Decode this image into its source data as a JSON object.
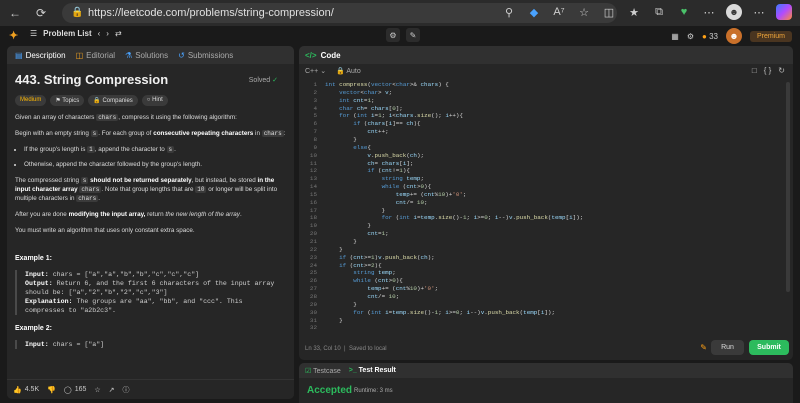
{
  "browser": {
    "url": "https://leetcode.com/problems/string-compression/"
  },
  "topbar": {
    "problem_list": "Problem List",
    "streak": "33",
    "premium": "Premium"
  },
  "left": {
    "tabs": [
      "Description",
      "Editorial",
      "Solutions",
      "Submissions"
    ],
    "title": "443. String Compression",
    "solved": "Solved",
    "tags": [
      "Medium",
      "Topics",
      "Companies",
      "Hint"
    ],
    "p1": "Given an array of characters",
    "p1_code": "chars",
    "p1_end": ", compress it using the following algorithm:",
    "p2a": "Begin with an empty string",
    "p2_code_s": "s",
    "p2b": ". For each group of",
    "p2_bold": "consecutive repeating characters",
    "p2c": "in",
    "p2_code_chars": "chars",
    "p2d": ":",
    "bullet1a": "If the group's length is",
    "bullet1_code1": "1",
    "bullet1b": ", append the character to",
    "bullet1_code2": "s",
    "bullet1c": ".",
    "bullet2": "Otherwise, append the character followed by the group's length.",
    "p3a": "The compressed string",
    "p3_code_s": "s",
    "p3_bold1": "should not be returned separately",
    "p3b": ", but instead, be stored",
    "p3_bold2": "in the input character array",
    "p3_code_chars": "chars",
    "p3c": ". Note that group lengths that are",
    "p3_code_10": "10",
    "p3d": "or longer will be split into multiple characters in",
    "p3_code_chars2": "chars",
    "p3e": ".",
    "p4a": "After you are done",
    "p4_bold": "modifying the input array,",
    "p4b": "return",
    "p4_italic": "the new length of the array",
    "p4c": ".",
    "p5": "You must write an algorithm that uses only constant extra space.",
    "example1_title": "Example 1:",
    "ex1_input_label": "Input:",
    "ex1_input": "chars = [\"a\",\"a\",\"b\",\"b\",\"c\",\"c\",\"c\"]",
    "ex1_output_label": "Output:",
    "ex1_output": "Return 6, and the first 6 characters of the input array",
    "ex1_output2": "should be: [\"a\",\"2\",\"b\",\"2\",\"c\",\"3\"]",
    "ex1_expl_label": "Explanation:",
    "ex1_expl": "The groups are \"aa\", \"bb\", and \"ccc\". This",
    "ex1_expl2": "compresses to \"a2b2c3\".",
    "example2_title": "Example 2:",
    "ex2_input_label": "Input:",
    "ex2_input": "chars = [\"a\"]",
    "likes": "4.5K",
    "comments": "165"
  },
  "right": {
    "header": "Code",
    "lang": "C++",
    "auto": "Auto",
    "status": "Ln 33, Col 10",
    "saved": "Saved to local",
    "run": "Run",
    "submit": "Submit"
  },
  "result": {
    "testcase_tab": "Testcase",
    "result_tab": "Test Result",
    "accepted": "Accepted",
    "runtime": "Runtime: 3 ms"
  },
  "code_lines": [
    "int compress(vector<char>& chars) {",
    "    vector<char> v;",
    "    int cnt=1;",
    "    char ch= chars[0];",
    "    for (int i=1; i<chars.size(); i++){",
    "        if (chars[i]== ch){",
    "            cnt++;",
    "        }",
    "        else{",
    "            v.push_back(ch);",
    "            ch= chars[i];",
    "            if (cnt!=1){",
    "                string temp;",
    "                while (cnt>0){",
    "                    temp+= (cnt%10)+'0';",
    "                    cnt/= 10;",
    "                }",
    "                for (int i=temp.size()-1; i>=0; i--)v.push_back(temp[i]);",
    "            }",
    "            cnt=1;",
    "        }",
    "    }",
    "    if (cnt>=1)v.push_back(ch);",
    "    if (cnt>=2){",
    "        string temp;",
    "        while (cnt>0){",
    "            temp+= (cnt%10)+'0';",
    "            cnt/= 10;",
    "        }",
    "        for (int i=temp.size()-1; i>=0; i--)v.push_back(temp[i]);",
    "    }"
  ],
  "line_numbers": [
    "1",
    "2",
    "3",
    "4",
    "5",
    "6",
    "7",
    "8",
    "9",
    "10",
    "11",
    "12",
    "13",
    "14",
    "15",
    "16",
    "17",
    "18",
    "19",
    "20",
    "21",
    "22",
    "23",
    "24",
    "25",
    "26",
    "27",
    "28",
    "29",
    "30",
    "31",
    "32"
  ]
}
